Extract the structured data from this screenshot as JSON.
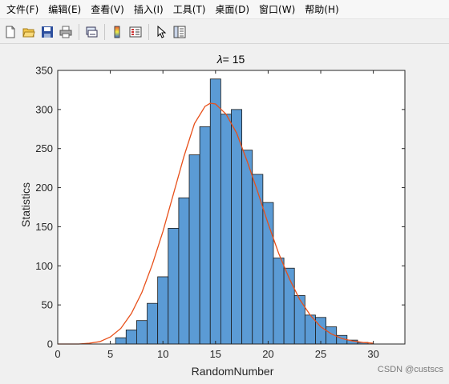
{
  "menu": [
    "文件(F)",
    "编辑(E)",
    "查看(V)",
    "插入(I)",
    "工具(T)",
    "桌面(D)",
    "窗口(W)",
    "帮助(H)"
  ],
  "toolbar_icons": [
    "new-file-icon",
    "open-folder-icon",
    "save-icon",
    "print-icon",
    "link-figure-icon",
    "colorbar-icon",
    "legend-icon",
    "pointer-icon",
    "property-editor-icon"
  ],
  "watermark": "CSDN @custscs",
  "chart_data": {
    "type": "bar",
    "title_symbol": "λ",
    "title_rest": "= 15",
    "xlabel": "RandomNumber",
    "ylabel": "Statistics",
    "xlim": [
      0,
      33
    ],
    "ylim": [
      0,
      350
    ],
    "xticks": [
      0,
      5,
      10,
      15,
      20,
      25,
      30
    ],
    "yticks": [
      0,
      50,
      100,
      150,
      200,
      250,
      300,
      350
    ],
    "bar_color": "#5b9bd5",
    "curve_color": "#e8501a",
    "bins": [
      {
        "x0": 5.5,
        "x1": 6.5,
        "count": 8
      },
      {
        "x0": 6.5,
        "x1": 7.5,
        "count": 18
      },
      {
        "x0": 7.5,
        "x1": 8.5,
        "count": 30
      },
      {
        "x0": 8.5,
        "x1": 9.5,
        "count": 52
      },
      {
        "x0": 9.5,
        "x1": 10.5,
        "count": 86
      },
      {
        "x0": 10.5,
        "x1": 11.5,
        "count": 148
      },
      {
        "x0": 11.5,
        "x1": 12.5,
        "count": 187
      },
      {
        "x0": 12.5,
        "x1": 13.5,
        "count": 242
      },
      {
        "x0": 13.5,
        "x1": 14.5,
        "count": 278
      },
      {
        "x0": 14.5,
        "x1": 15.5,
        "count": 339
      },
      {
        "x0": 15.5,
        "x1": 16.5,
        "count": 294
      },
      {
        "x0": 16.5,
        "x1": 17.5,
        "count": 300
      },
      {
        "x0": 17.5,
        "x1": 18.5,
        "count": 248
      },
      {
        "x0": 18.5,
        "x1": 19.5,
        "count": 217
      },
      {
        "x0": 19.5,
        "x1": 20.5,
        "count": 181
      },
      {
        "x0": 20.5,
        "x1": 21.5,
        "count": 110
      },
      {
        "x0": 21.5,
        "x1": 22.5,
        "count": 97
      },
      {
        "x0": 22.5,
        "x1": 23.5,
        "count": 62
      },
      {
        "x0": 23.5,
        "x1": 24.5,
        "count": 37
      },
      {
        "x0": 24.5,
        "x1": 25.5,
        "count": 34
      },
      {
        "x0": 25.5,
        "x1": 26.5,
        "count": 22
      },
      {
        "x0": 26.5,
        "x1": 27.5,
        "count": 11
      },
      {
        "x0": 27.5,
        "x1": 28.5,
        "count": 5
      },
      {
        "x0": 28.5,
        "x1": 29.5,
        "count": 2
      }
    ],
    "curve": {
      "x": [
        0,
        2,
        3,
        4,
        5,
        6,
        7,
        8,
        9,
        10,
        11,
        12,
        13,
        14,
        14.5,
        15,
        16,
        17,
        18,
        19,
        20,
        21,
        22,
        23,
        24,
        25,
        26,
        27,
        28,
        29,
        30
      ],
      "y": [
        0,
        0,
        1,
        3,
        9,
        20,
        39,
        66,
        102,
        144,
        192,
        240,
        282,
        304,
        308,
        307,
        294,
        270,
        234,
        195,
        154,
        116,
        84,
        57,
        37,
        22,
        13,
        7,
        4,
        2,
        1
      ]
    }
  }
}
